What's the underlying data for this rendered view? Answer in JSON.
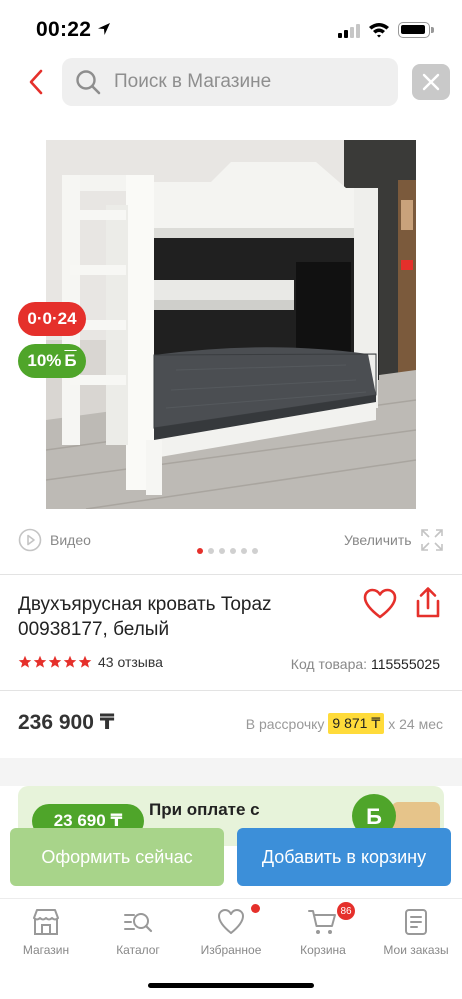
{
  "status_bar": {
    "time": "00:22"
  },
  "search": {
    "placeholder": "Поиск в Магазине"
  },
  "badges": {
    "installment": "0·0·24",
    "bonus": "10%",
    "bonus_currency": "Б"
  },
  "media": {
    "video_label": "Видео",
    "zoom_label": "Увеличить",
    "image_count": 6,
    "active_image": 1
  },
  "product": {
    "title": "Двухъярусная кровать Topaz 00938177, белый",
    "rating": 5,
    "reviews": "43 отзыва",
    "sku_label": "Код товара:",
    "sku_value": "115555025",
    "price": "236 900 ₸",
    "installment_prefix": "В рассрочку",
    "installment_amount": "9 871 ₸",
    "installment_suffix": "х 24 мес"
  },
  "promo": {
    "amount": "23 690 ₸",
    "text": "При оплате с"
  },
  "actions": {
    "buy_now": "Оформить сейчас",
    "add_to_cart": "Добавить в корзину"
  },
  "tabbar": {
    "items": [
      {
        "label": "Магазин",
        "icon": "store-icon"
      },
      {
        "label": "Каталог",
        "icon": "catalog-icon"
      },
      {
        "label": "Избранное",
        "icon": "heart-icon"
      },
      {
        "label": "Корзина",
        "icon": "cart-icon"
      },
      {
        "label": "Мои заказы",
        "icon": "orders-icon"
      }
    ],
    "cart_count": "86"
  },
  "colors": {
    "accent_red": "#e5302b",
    "green": "#4fa52a",
    "light_green": "#a8d48a",
    "blue": "#3c8fd9",
    "installment_yellow": "#ffdb3a"
  }
}
